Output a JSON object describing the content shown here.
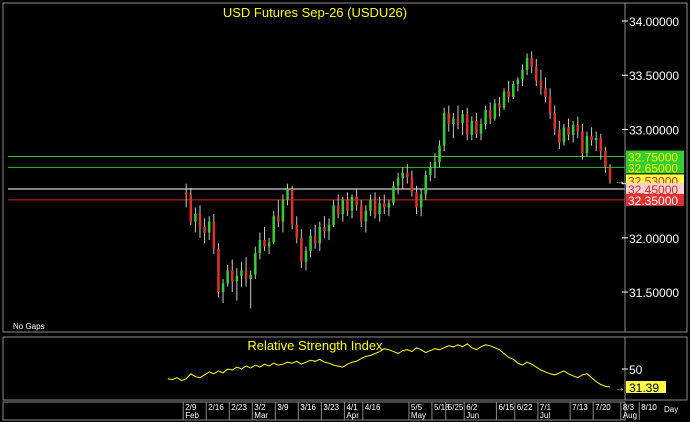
{
  "colors": {
    "background": "#000000",
    "frame": "#8c8c8c",
    "title": "#ffff00",
    "up_candle": "#33cc33",
    "down_candle": "#e0302a",
    "wick": "#c8c8c8",
    "rsi_line": "#ffff00",
    "support_green": "#1ec81e",
    "resistance_red": "#d22828",
    "last_price_line": "#ffffff",
    "axis_text": "#ffffff"
  },
  "chart_data": [
    {
      "type": "candlestick",
      "title": "USD  Futures  Sep-26  (USDU26)",
      "ylim": [
        31.15,
        34.12
      ],
      "y_ticks": [
        34.0,
        33.5,
        33.0,
        32.5,
        32.0,
        31.5
      ],
      "y_tick_labels": [
        "34.00000",
        "33.50000",
        "33.00000",
        "32.50000",
        "32.00000",
        "31.50000"
      ],
      "note": "No Gaps",
      "price_tags": [
        {
          "label": "32.75000",
          "value": 32.75,
          "bg": "#33cc33",
          "fg": "#ffff00",
          "line": true
        },
        {
          "label": "32.65000",
          "value": 32.65,
          "bg": "#33cc33",
          "fg": "#ffff00",
          "line": true
        },
        {
          "label": "32.53000",
          "value": 32.53,
          "bg": "#ffff44",
          "fg": "#d22828",
          "line": false
        },
        {
          "label": "32.45000",
          "value": 32.45,
          "bg": "#ffd0d0",
          "fg": "#d22828",
          "line": true
        },
        {
          "label": "32.35000",
          "value": 32.35,
          "bg": "#e03030",
          "fg": "#ffffff",
          "line": true
        }
      ],
      "candles": [
        [
          32.42,
          32.5,
          32.28,
          32.4
        ],
        [
          32.4,
          32.46,
          32.12,
          32.15
        ],
        [
          32.15,
          32.28,
          32.05,
          32.22
        ],
        [
          32.22,
          32.3,
          32.0,
          32.1
        ],
        [
          32.1,
          32.18,
          31.95,
          32.05
        ],
        [
          32.05,
          32.2,
          31.98,
          32.15
        ],
        [
          32.15,
          32.22,
          31.85,
          31.9
        ],
        [
          31.9,
          31.95,
          31.45,
          31.5
        ],
        [
          31.5,
          31.62,
          31.4,
          31.58
        ],
        [
          31.58,
          31.75,
          31.55,
          31.7
        ],
        [
          31.7,
          31.8,
          31.5,
          31.6
        ],
        [
          31.6,
          31.72,
          31.42,
          31.65
        ],
        [
          31.65,
          31.78,
          31.55,
          31.7
        ],
        [
          31.7,
          31.82,
          31.55,
          31.62
        ],
        [
          31.62,
          31.7,
          31.35,
          31.66
        ],
        [
          31.66,
          31.92,
          31.62,
          31.86
        ],
        [
          31.86,
          32.05,
          31.8,
          31.98
        ],
        [
          31.98,
          32.1,
          31.88,
          31.92
        ],
        [
          31.92,
          32.0,
          31.85,
          31.96
        ],
        [
          31.96,
          32.25,
          31.94,
          32.2
        ],
        [
          32.2,
          32.35,
          32.1,
          32.15
        ],
        [
          32.15,
          32.4,
          32.05,
          32.35
        ],
        [
          32.35,
          32.5,
          32.3,
          32.45
        ],
        [
          32.45,
          32.48,
          32.08,
          32.12
        ],
        [
          32.12,
          32.2,
          31.95,
          32.0
        ],
        [
          32.0,
          32.08,
          31.72,
          31.78
        ],
        [
          31.78,
          31.92,
          31.7,
          31.88
        ],
        [
          31.88,
          32.08,
          31.82,
          32.02
        ],
        [
          32.02,
          32.12,
          31.9,
          31.95
        ],
        [
          31.95,
          32.15,
          31.88,
          32.1
        ],
        [
          32.1,
          32.2,
          32.0,
          32.06
        ],
        [
          32.06,
          32.18,
          31.98,
          32.12
        ],
        [
          32.12,
          32.35,
          32.1,
          32.3
        ],
        [
          32.3,
          32.4,
          32.18,
          32.22
        ],
        [
          32.22,
          32.38,
          32.15,
          32.35
        ],
        [
          32.35,
          32.42,
          32.2,
          32.25
        ],
        [
          32.25,
          32.4,
          32.18,
          32.38
        ],
        [
          32.38,
          32.45,
          32.25,
          32.3
        ],
        [
          32.3,
          32.35,
          32.1,
          32.15
        ],
        [
          32.15,
          32.3,
          32.05,
          32.25
        ],
        [
          32.25,
          32.4,
          32.2,
          32.35
        ],
        [
          32.35,
          32.42,
          32.18,
          32.22
        ],
        [
          32.22,
          32.38,
          32.15,
          32.32
        ],
        [
          32.32,
          32.4,
          32.22,
          32.28
        ],
        [
          32.28,
          32.35,
          32.2,
          32.32
        ],
        [
          32.32,
          32.52,
          32.3,
          32.48
        ],
        [
          32.48,
          32.6,
          32.4,
          32.55
        ],
        [
          32.55,
          32.65,
          32.45,
          32.6
        ],
        [
          32.6,
          32.68,
          32.5,
          32.56
        ],
        [
          32.56,
          32.62,
          32.38,
          32.42
        ],
        [
          32.42,
          32.48,
          32.22,
          32.28
        ],
        [
          32.28,
          32.45,
          32.2,
          32.4
        ],
        [
          32.4,
          32.62,
          32.35,
          32.58
        ],
        [
          32.58,
          32.7,
          32.52,
          32.65
        ],
        [
          32.65,
          32.78,
          32.55,
          32.7
        ],
        [
          32.7,
          32.9,
          32.65,
          32.85
        ],
        [
          32.85,
          33.2,
          32.8,
          33.15
        ],
        [
          33.15,
          33.22,
          32.98,
          33.05
        ],
        [
          33.05,
          33.15,
          32.92,
          33.1
        ],
        [
          33.1,
          33.22,
          33.0,
          33.06
        ],
        [
          33.06,
          33.18,
          32.95,
          33.14
        ],
        [
          33.14,
          33.2,
          32.9,
          32.95
        ],
        [
          32.95,
          33.12,
          32.9,
          33.08
        ],
        [
          33.08,
          33.15,
          32.92,
          32.96
        ],
        [
          32.96,
          33.1,
          32.9,
          33.05
        ],
        [
          33.05,
          33.22,
          33.0,
          33.18
        ],
        [
          33.18,
          33.25,
          33.05,
          33.1
        ],
        [
          33.1,
          33.28,
          33.08,
          33.24
        ],
        [
          33.24,
          33.3,
          33.12,
          33.2
        ],
        [
          33.2,
          33.38,
          33.18,
          33.35
        ],
        [
          33.35,
          33.45,
          33.25,
          33.3
        ],
        [
          33.3,
          33.45,
          33.28,
          33.42
        ],
        [
          33.42,
          33.48,
          33.35,
          33.46
        ],
        [
          33.46,
          33.6,
          33.4,
          33.55
        ],
        [
          33.55,
          33.7,
          33.5,
          33.66
        ],
        [
          33.66,
          33.72,
          33.52,
          33.58
        ],
        [
          33.58,
          33.65,
          33.4,
          33.45
        ],
        [
          33.45,
          33.55,
          33.32,
          33.38
        ],
        [
          33.38,
          33.48,
          33.25,
          33.3
        ],
        [
          33.3,
          33.38,
          33.1,
          33.15
        ],
        [
          33.15,
          33.22,
          32.95,
          33.0
        ],
        [
          33.0,
          33.08,
          32.82,
          32.88
        ],
        [
          32.88,
          33.05,
          32.85,
          33.02
        ],
        [
          33.02,
          33.1,
          32.9,
          32.95
        ],
        [
          32.95,
          33.08,
          32.88,
          33.04
        ],
        [
          33.04,
          33.12,
          32.92,
          32.98
        ],
        [
          32.98,
          33.05,
          32.72,
          32.78
        ],
        [
          32.78,
          32.98,
          32.75,
          32.94
        ],
        [
          32.94,
          33.02,
          32.85,
          32.9
        ],
        [
          32.9,
          32.98,
          32.8,
          32.92
        ],
        [
          32.92,
          32.96,
          32.72,
          32.8
        ],
        [
          32.8,
          32.84,
          32.6,
          32.65
        ],
        [
          32.65,
          32.68,
          32.5,
          32.53
        ]
      ],
      "x_ticks": [
        {
          "i": 0,
          "day": "2/9",
          "month": "Feb"
        },
        {
          "i": 5,
          "day": "2/16",
          "month": ""
        },
        {
          "i": 10,
          "day": "2/23",
          "month": ""
        },
        {
          "i": 15,
          "day": "3/2",
          "month": "Mar"
        },
        {
          "i": 20,
          "day": "3/9",
          "month": ""
        },
        {
          "i": 25,
          "day": "3/16",
          "month": ""
        },
        {
          "i": 30,
          "day": "3/23",
          "month": ""
        },
        {
          "i": 35,
          "day": "4/1",
          "month": "Apr"
        },
        {
          "i": 39,
          "day": "4/16",
          "month": ""
        },
        {
          "i": 49,
          "day": "5/5",
          "month": "May"
        },
        {
          "i": 54,
          "day": "5/18",
          "month": ""
        },
        {
          "i": 57,
          "day": "5/25",
          "month": ""
        },
        {
          "i": 61,
          "day": "6/2",
          "month": "Jun"
        },
        {
          "i": 68,
          "day": "6/15",
          "month": ""
        },
        {
          "i": 72,
          "day": "6/22",
          "month": ""
        },
        {
          "i": 77,
          "day": "7/1",
          "month": "Jul"
        },
        {
          "i": 84,
          "day": "7/13",
          "month": ""
        },
        {
          "i": 89,
          "day": "7/20",
          "month": ""
        },
        {
          "i": 95,
          "day": "8/3",
          "month": "Aug"
        },
        {
          "i": 99,
          "day": "8/10",
          "month": ""
        }
      ],
      "x_unit_label": "Day"
    },
    {
      "type": "line",
      "title": "Relative  Strength  Index",
      "ylim": [
        20,
        80
      ],
      "y_ticks": [
        50
      ],
      "y_tick_labels": [
        "50"
      ],
      "last_value_label": "31.39",
      "series": [
        {
          "values": [
            40,
            39,
            41,
            38,
            40,
            45,
            42,
            41,
            44,
            47,
            45,
            48,
            46,
            50,
            49,
            52,
            50,
            53,
            51,
            54,
            52,
            55,
            53,
            56,
            54,
            55,
            57,
            56,
            58,
            55,
            57,
            59,
            58,
            60,
            57,
            56,
            54,
            53,
            52,
            55,
            57,
            58,
            61,
            63,
            64,
            66,
            68,
            71,
            70,
            68,
            66,
            69,
            70,
            68,
            72,
            70,
            67,
            69,
            71,
            70,
            72,
            74,
            73,
            75,
            73,
            76,
            72,
            70,
            73,
            75,
            74,
            72,
            70,
            66,
            62,
            60,
            56,
            54,
            57,
            55,
            52,
            49,
            47,
            45,
            44,
            46,
            48,
            45,
            43,
            41,
            44,
            45,
            41,
            37,
            34,
            32,
            31.39
          ]
        }
      ]
    }
  ]
}
